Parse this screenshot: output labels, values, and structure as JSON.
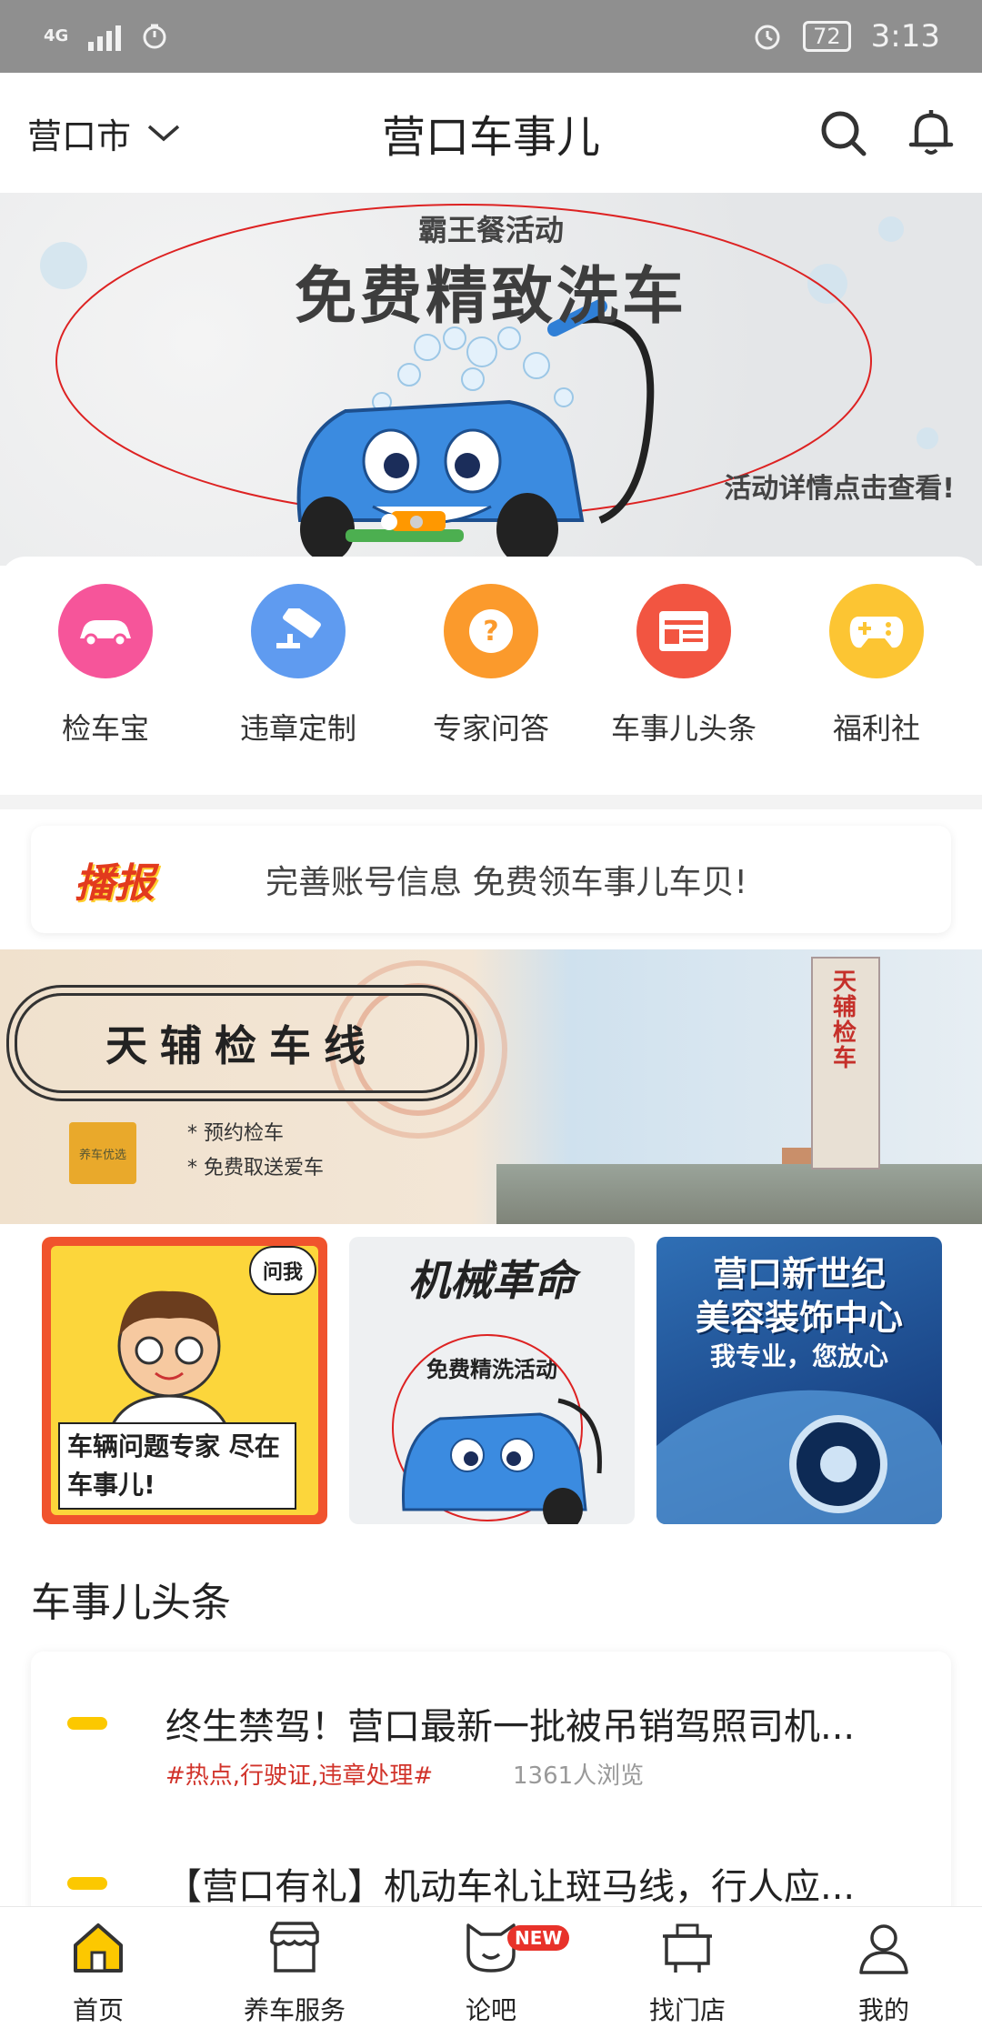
{
  "status_bar": {
    "network": "4G",
    "battery": "72",
    "time": "3:13"
  },
  "header": {
    "city": "营口市",
    "title": "营口车事儿"
  },
  "hero": {
    "subtitle": "霸王餐活动",
    "title": "免费精致洗车",
    "note": "活动详情点击查看!"
  },
  "features": [
    {
      "label": "检车宝",
      "icon": "car-icon",
      "color": "#f6559a"
    },
    {
      "label": "违章定制",
      "icon": "camera-icon",
      "color": "#5f9bf0"
    },
    {
      "label": "专家问答",
      "icon": "question-icon",
      "color": "#fb9a2c"
    },
    {
      "label": "车事儿头条",
      "icon": "news-icon",
      "color": "#f25541"
    },
    {
      "label": "福利社",
      "icon": "gamepad-icon",
      "color": "#fcc533"
    }
  ],
  "announcement": {
    "badge": "播报",
    "text": "完善账号信息 免费领车事儿车贝!"
  },
  "promo": {
    "title": "天辅检车线",
    "items": [
      "* 预约检车",
      "* 免费取送爱车"
    ],
    "tower_text": "天辅检车",
    "logo_text": "养车优选"
  },
  "tiles": [
    {
      "ask": "问我",
      "text": "车辆问题专家 尽在车事儿!"
    },
    {
      "title": "机械革命",
      "subtitle": "免费精洗活动"
    },
    {
      "line1": "营口新世纪",
      "line2": "美容装饰中心",
      "line3": "我专业，您放心"
    }
  ],
  "news": {
    "heading": "车事儿头条",
    "items": [
      {
        "title": "终生禁驾！营口最新一批被吊销驾照司机...",
        "tags": "#热点,行驶证,违章处理#",
        "views": "1361人浏览"
      },
      {
        "title": "【营口有礼】机动车礼让斑马线，行人应..."
      }
    ]
  },
  "bottom_nav": [
    {
      "label": "首页",
      "icon": "home-icon"
    },
    {
      "label": "养车服务",
      "icon": "shop-icon"
    },
    {
      "label": "论吧",
      "icon": "forum-icon",
      "badge": "NEW"
    },
    {
      "label": "找门店",
      "icon": "store-icon"
    },
    {
      "label": "我的",
      "icon": "user-icon"
    }
  ],
  "colors": {
    "accent": "#fcc800",
    "tag_red": "#d1332a",
    "status_bar": "#8f8f8f"
  }
}
